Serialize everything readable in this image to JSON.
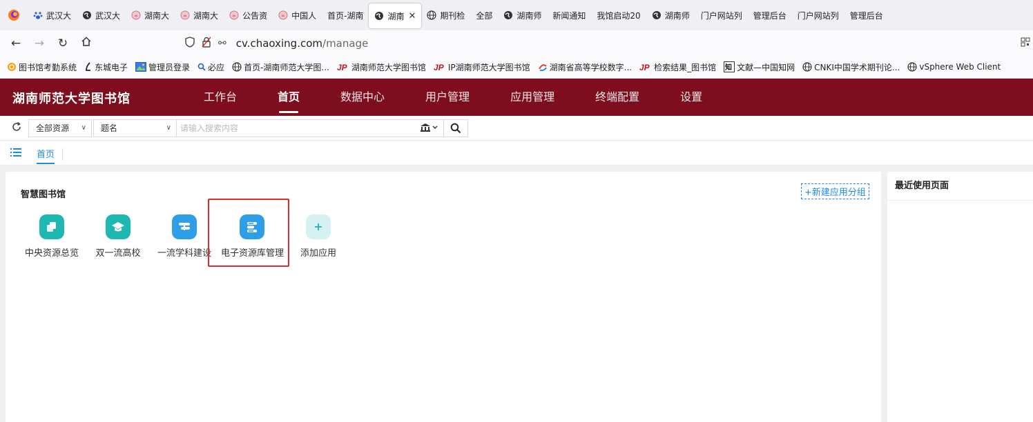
{
  "browser": {
    "tabs": [
      {
        "label": "武汉大",
        "icon": "paw-icon",
        "active": false
      },
      {
        "label": "武汉大",
        "icon": "globe-dark-icon",
        "active": false
      },
      {
        "label": "湖南大",
        "icon": "pig-icon",
        "active": false
      },
      {
        "label": "湖南大",
        "icon": "pig-icon",
        "active": false
      },
      {
        "label": "公告资",
        "icon": "pig-icon",
        "active": false
      },
      {
        "label": "中国人",
        "icon": "pig-icon",
        "active": false
      },
      {
        "label": "首页-湖南",
        "icon": "",
        "active": false
      },
      {
        "label": "湖南",
        "icon": "globe-dark-icon",
        "active": true
      },
      {
        "label": "期刊检",
        "icon": "globe-outline-icon",
        "active": false
      },
      {
        "label": "全部",
        "icon": "",
        "active": false
      },
      {
        "label": "湖南师",
        "icon": "globe-dark-icon",
        "active": false
      },
      {
        "label": "新闻通知",
        "icon": "",
        "active": false
      },
      {
        "label": "我馆启动20",
        "icon": "",
        "active": false
      },
      {
        "label": "湖南师",
        "icon": "globe-dark-icon",
        "active": false
      },
      {
        "label": "门户网站列",
        "icon": "",
        "active": false
      },
      {
        "label": "管理后台",
        "icon": "",
        "active": false
      },
      {
        "label": "门户网站列",
        "icon": "",
        "active": false
      },
      {
        "label": "管理后台",
        "icon": "",
        "active": false
      }
    ],
    "active_tab_close": "✕",
    "url_host": "cv.chaoxing.com",
    "url_path": "/manage",
    "bookmarks": [
      {
        "label": "图书馆考勤系统",
        "icon": "orange-circle-icon"
      },
      {
        "label": "东城电子",
        "icon": "script-l-icon"
      },
      {
        "label": "管理员登录",
        "icon": "photo-icon"
      },
      {
        "label": "必应",
        "icon": "search-icon"
      },
      {
        "label": "首页-湖南师范大学图...",
        "icon": "globe-outline-icon"
      },
      {
        "label": "湖南师范大学图书馆",
        "icon": "jp-icon"
      },
      {
        "label": "IP湖南师范大学图书馆",
        "icon": "jp-icon"
      },
      {
        "label": "湖南省高等学校数字...",
        "icon": "swirl-icon"
      },
      {
        "label": "检索结果_图书馆",
        "icon": "jp-icon"
      },
      {
        "label": "文献—中国知网",
        "icon": "zhi-icon"
      },
      {
        "label": "CNKI中国学术期刊论...",
        "icon": "globe-outline-icon"
      },
      {
        "label": "vSphere Web Client",
        "icon": "globe-outline-icon"
      }
    ]
  },
  "app": {
    "name": "湖南师范大学图书馆",
    "menu": [
      {
        "label": "工作台",
        "active": false
      },
      {
        "label": "首页",
        "active": true
      },
      {
        "label": "数据中心",
        "active": false
      },
      {
        "label": "用户管理",
        "active": false
      },
      {
        "label": "应用管理",
        "active": false
      },
      {
        "label": "终端配置",
        "active": false
      },
      {
        "label": "设置",
        "active": false
      }
    ]
  },
  "search": {
    "scope": "全部资源",
    "field": "题名",
    "placeholder": "请输入搜索内容"
  },
  "breadcrumb": {
    "tab": "首页"
  },
  "main": {
    "group_title": "智慧图书馆",
    "new_group": "+新建应用分组",
    "apps": [
      {
        "label": "中央资源总览",
        "icon": "layers-icon",
        "color": "#1fb8b0"
      },
      {
        "label": "双一流高校",
        "icon": "graduation-cap-icon",
        "color": "#1fb8b0"
      },
      {
        "label": "一流学科建设",
        "icon": "subject-board-icon",
        "color": "#2e9ee8"
      },
      {
        "label": "电子资源库管理",
        "icon": "database-list-icon",
        "color": "#2e9ee8"
      },
      {
        "label": "添加应用",
        "icon": "plus-icon",
        "color": "#d5f1f4"
      }
    ]
  },
  "side": {
    "title": "最近使用页面"
  },
  "colors": {
    "header": "#7e0e1e",
    "accent": "#1e88e5",
    "highlight": "#e3282a"
  }
}
